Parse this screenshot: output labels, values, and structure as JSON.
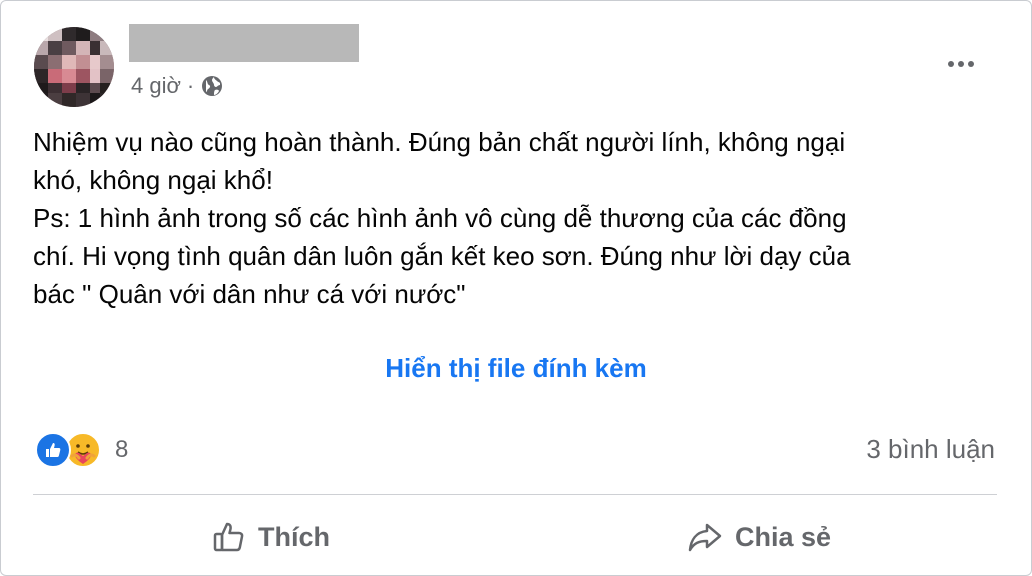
{
  "post": {
    "timestamp": "4 giờ",
    "separator": "·",
    "privacy_icon": "globe-icon",
    "body_lines": [
      "Nhiệm vụ nào cũng hoàn thành. Đúng bản chất người lính, không ngại",
      "khó, không ngại khổ!",
      "Ps: 1 hình ảnh trong số các hình ảnh vô cùng dễ thương của các đồng",
      "chí. Hi vọng tình quân dân luôn gắn kết keo sơn. Đúng như lời dạy của",
      "bác \" Quân với dân như cá với nước\""
    ],
    "attachment_link": "Hiển thị file đính kèm"
  },
  "reactions": {
    "icons": [
      "like-icon",
      "care-icon"
    ],
    "count": "8",
    "comments": "3 bình luận"
  },
  "actions": {
    "like_label": "Thích",
    "share_label": "Chia sẻ"
  },
  "colors": {
    "link": "#1877f2",
    "secondary_text": "#65676b",
    "like_blue": "#1b74e4",
    "care_yellow": "#f7b928"
  }
}
